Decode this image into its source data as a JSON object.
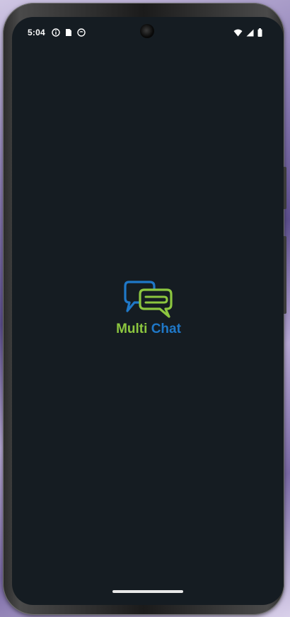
{
  "status_bar": {
    "time": "5:04",
    "left_icons": [
      "info-icon",
      "sim-card-icon",
      "notification-icon"
    ],
    "right_icons": [
      "wifi-icon",
      "cell-signal-icon",
      "battery-icon"
    ]
  },
  "splash": {
    "logo_word_1": "Multi",
    "logo_word_2": "Chat"
  },
  "colors": {
    "screen_background": "#151c22",
    "logo_green": "#8cc63f",
    "logo_blue": "#1f78c8"
  }
}
